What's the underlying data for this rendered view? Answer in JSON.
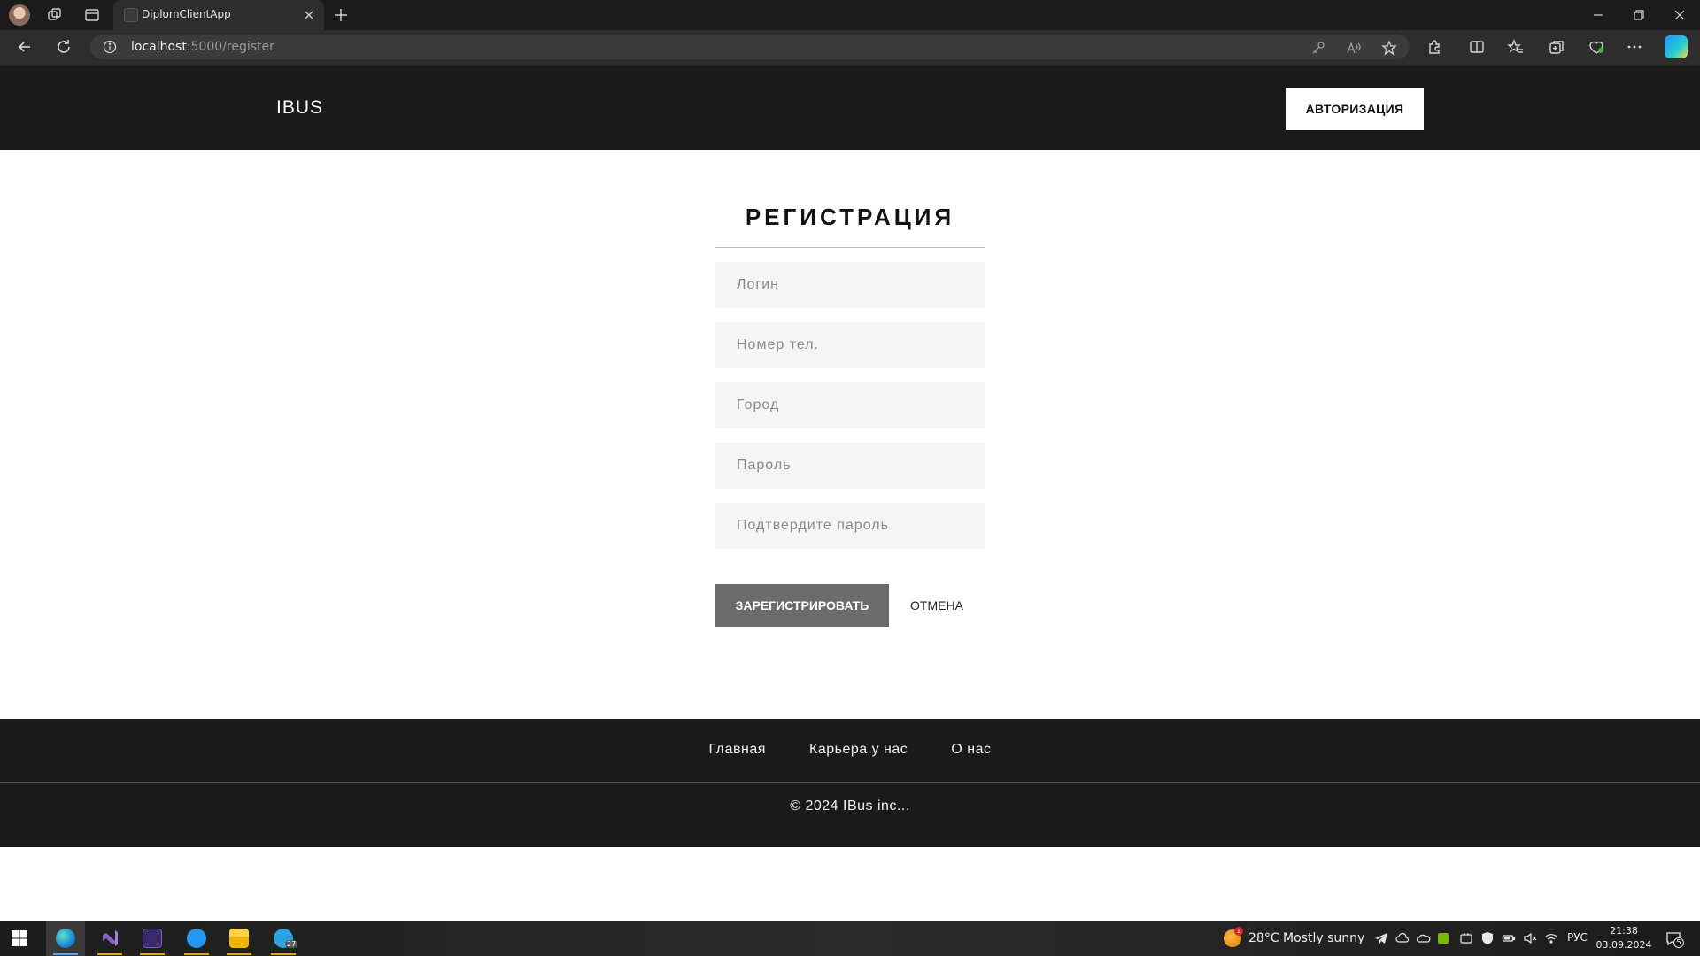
{
  "browser": {
    "tab_title": "DiplomClientApp",
    "url_host": "localhost",
    "url_rest": ":5000/register"
  },
  "site": {
    "brand": "IBUS",
    "auth_button": "АВТОРИЗАЦИЯ"
  },
  "form": {
    "title": "РЕГИСТРАЦИЯ",
    "fields": {
      "login": "Логин",
      "phone": "Номер тел.",
      "city": "Город",
      "password": "Пароль",
      "confirm": "Подтвердите пароль"
    },
    "submit": "ЗАРЕГИСТРИРОВАТЬ",
    "cancel": "ОТМЕНА"
  },
  "footer": {
    "links": [
      "Главная",
      "Карьера у нас",
      "О нас"
    ],
    "copyright": "© 2024 IBus inc..."
  },
  "taskbar": {
    "weather": "28°C  Mostly sunny",
    "weather_alert_count": "1",
    "language": "РУС",
    "time": "21:38",
    "date": "03.09.2024",
    "telegram_badge": "27",
    "notifications": "5"
  },
  "colors": {
    "header_bg": "#1a1a1a",
    "field_bg": "#f5f5f6",
    "submit_bg": "#6b6b6b"
  }
}
